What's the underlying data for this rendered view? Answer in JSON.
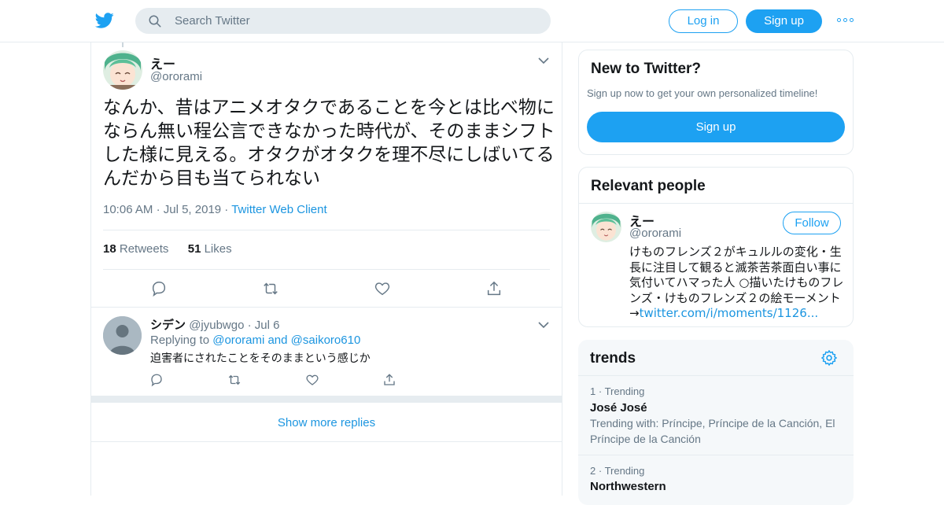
{
  "header": {
    "logo_icon": "twitter-bird-icon",
    "search_placeholder": "Search Twitter",
    "login_label": "Log in",
    "signup_label": "Sign up",
    "more_icon": "more-dots-icon",
    "accent_color": "#1da1f2"
  },
  "tweet": {
    "author_name": "えー",
    "author_handle": "@ororami",
    "text": "なんか、昔はアニメオタクであることを今とは比べ物にならん無い程公言できなかった時代が、そのままシフトした様に見える。オタクがオタクを理不尽にしばいてるんだから目も当てられない",
    "time": "10:06 AM",
    "date": "Jul 5, 2019",
    "client": "Twitter Web Client",
    "retweets_count": "18",
    "retweets_label": "Retweets",
    "likes_count": "51",
    "likes_label": "Likes"
  },
  "reply": {
    "author_name": "シデン",
    "author_handle": "@jyubwgo",
    "date": "Jul 6",
    "replying_to_label": "Replying to",
    "replying_to_1": "@ororami",
    "and": "and",
    "replying_to_2": "@saikoro610",
    "text": "迫害者にされたことをそのままという感じか"
  },
  "show_more_replies": "Show more replies",
  "new_to_twitter": {
    "title": "New to Twitter?",
    "subtitle": "Sign up now to get your own personalized timeline!",
    "button": "Sign up"
  },
  "relevant_people": {
    "title": "Relevant people",
    "name": "えー",
    "handle": "@ororami",
    "follow_label": "Follow",
    "bio": "けものフレンズ２がキュルルの変化・生長に注目して観ると滅茶苦茶面白い事に気付いてハマった人 ○描いたけものフレンズ・けものフレンズ２の絵モーメント→",
    "bio_link": "twitter.com/i/moments/1126..."
  },
  "trends": {
    "title": "trends",
    "items": [
      {
        "rank": "1",
        "meta": "Trending",
        "name": "José José",
        "with": "Trending with: Príncipe, Príncipe de la Canción, El Príncipe de la Canción"
      },
      {
        "rank": "2",
        "meta": "Trending",
        "name": "Northwestern",
        "with": ""
      }
    ]
  }
}
